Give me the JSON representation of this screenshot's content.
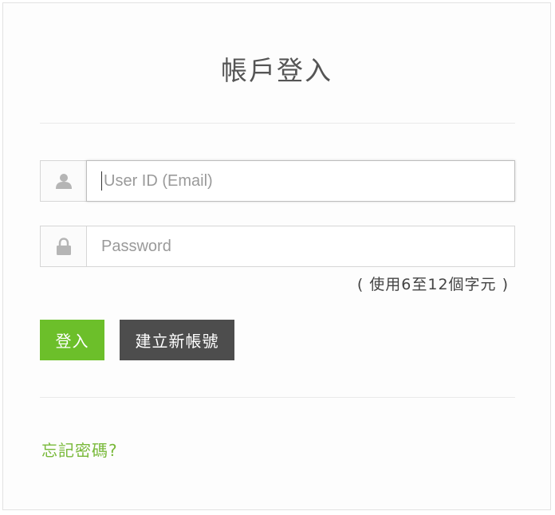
{
  "page": {
    "title": "帳戶登入"
  },
  "form": {
    "user_id": {
      "placeholder": "User ID (Email)",
      "value": ""
    },
    "password": {
      "placeholder": "Password",
      "value": ""
    },
    "password_hint": "( 使用6至12個字元 )"
  },
  "actions": {
    "login_label": "登入",
    "register_label": "建立新帳號",
    "forgot_label": "忘記密碼?"
  },
  "icons": {
    "user": "user-icon",
    "password": "lock-icon"
  },
  "colors": {
    "primary": "#6cbf2a",
    "secondary": "#4d4d4d",
    "link": "#79b93a"
  }
}
